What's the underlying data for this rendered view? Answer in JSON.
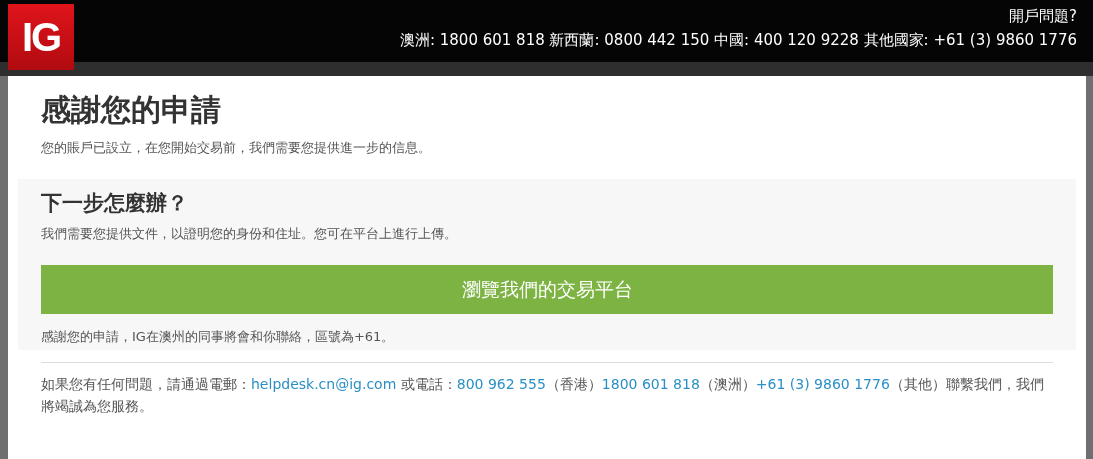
{
  "header": {
    "logo": "IG",
    "help_title": "開戶問題?",
    "phones": "澳洲: 1800 601 818 新西蘭: 0800 442 150 中國: 400 120 9228 其他國家: +61 (3) 9860 1776"
  },
  "title": "感謝您的申請",
  "intro": "您的賬戶已設立，在您開始交易前，我們需要您提供進一步的信息。",
  "next": {
    "heading": "下一步怎麼辦？",
    "text": "我們需要您提供文件，以證明您的身份和住址。您可在平台上進行上傳。",
    "button": "瀏覽我們的交易平台",
    "note": "感謝您的申請，IG在澳州的同事將會和你聯絡，區號為+61。"
  },
  "footer": [
    {
      "kind": "text",
      "text": "如果您有任何問題，請通過電郵："
    },
    {
      "kind": "link",
      "text": "helpdesk.cn@ig.com"
    },
    {
      "kind": "text",
      "text": " 或電話："
    },
    {
      "kind": "link",
      "text": "800 962 555"
    },
    {
      "kind": "text",
      "text": "（香港）"
    },
    {
      "kind": "link",
      "text": "1800 601 818"
    },
    {
      "kind": "text",
      "text": "（澳洲）"
    },
    {
      "kind": "link",
      "text": "+61 (3) 9860 1776"
    },
    {
      "kind": "text",
      "text": "（其他）聯繫我們，我們將竭誠為您服務。"
    }
  ]
}
